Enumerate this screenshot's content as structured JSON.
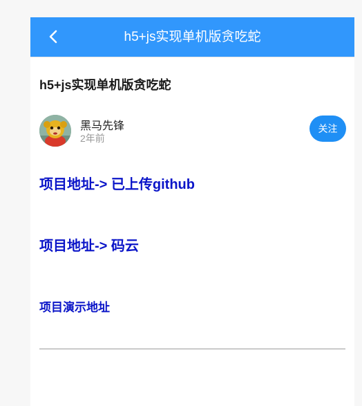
{
  "header": {
    "back_icon": "chevron-left-icon",
    "title": "h5+js实现单机版贪吃蛇",
    "background_color": "#3197fc"
  },
  "article": {
    "title": "h5+js实现单机版贪吃蛇",
    "author": {
      "avatar": "avatar-image",
      "name": "黑马先锋",
      "time": "2年前"
    },
    "follow_label": "关注",
    "links": [
      {
        "label": "项目地址-> 已上传github"
      },
      {
        "label": "项目地址-> 码云"
      },
      {
        "label": "项目演示地址"
      }
    ],
    "link_color": "#0a14c8"
  }
}
